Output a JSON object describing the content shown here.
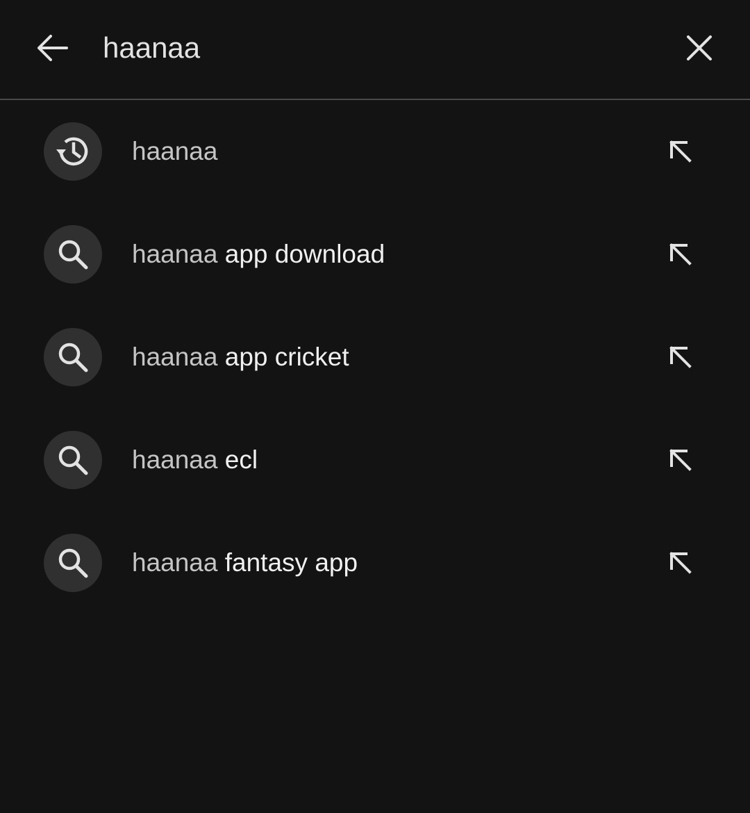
{
  "search": {
    "value": "haanaa",
    "placeholder": ""
  },
  "icons": {
    "back": "arrow-back-icon",
    "clear": "close-icon",
    "history": "history-icon",
    "search": "search-icon",
    "fill": "arrow-up-left-icon"
  },
  "colors": {
    "background": "#131313",
    "icon_circle": "#303030",
    "divider": "#4a4a4a",
    "text": "#e3e3e3"
  },
  "suggestions": [
    {
      "type": "history",
      "typed": "haanaa",
      "rest": ""
    },
    {
      "type": "search",
      "typed": "haanaa",
      "rest": " app download"
    },
    {
      "type": "search",
      "typed": "haanaa",
      "rest": " app cricket"
    },
    {
      "type": "search",
      "typed": "haanaa",
      "rest": " ecl"
    },
    {
      "type": "search",
      "typed": "haanaa",
      "rest": " fantasy app"
    }
  ]
}
